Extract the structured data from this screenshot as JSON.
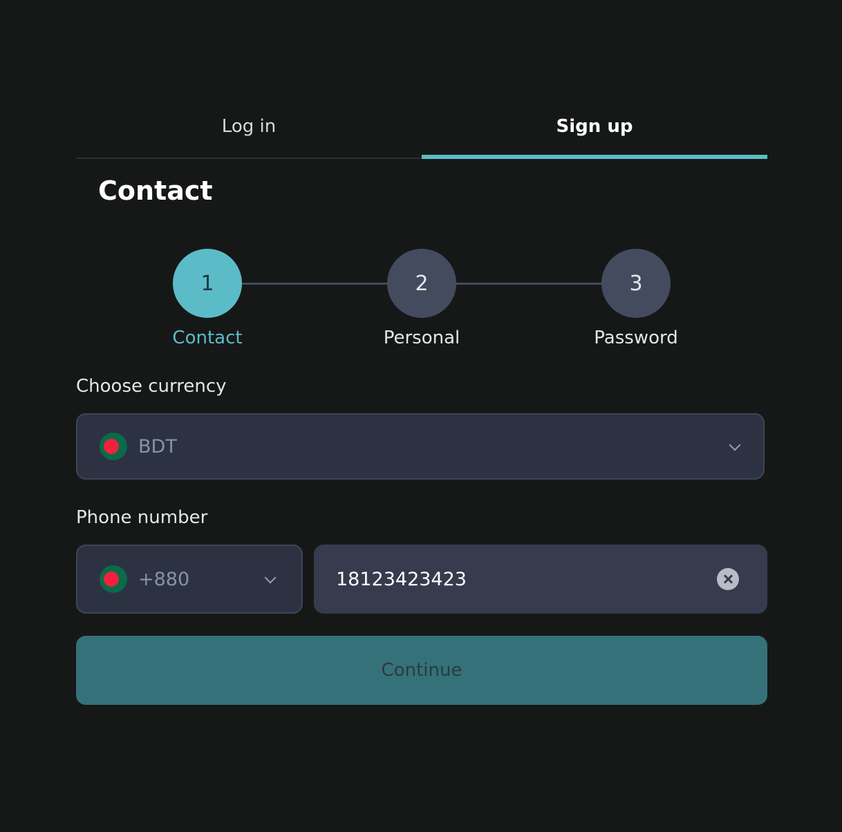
{
  "tabs": {
    "login_label": "Log in",
    "signup_label": "Sign up",
    "active": "signup"
  },
  "section": {
    "title": "Contact"
  },
  "stepper": {
    "active_step": 1,
    "steps": [
      {
        "number": "1",
        "label": "Contact"
      },
      {
        "number": "2",
        "label": "Personal"
      },
      {
        "number": "3",
        "label": "Password"
      }
    ]
  },
  "currency": {
    "label": "Choose currency",
    "value": "BDT",
    "flag_icon": "bangladesh-flag-icon"
  },
  "phone": {
    "label": "Phone number",
    "country_code": "+880",
    "value": "18123423423"
  },
  "actions": {
    "continue_label": "Continue"
  },
  "colors": {
    "accent": "#5bbcc7",
    "background": "#161818",
    "field_bg": "#2c3242",
    "button_bg": "#357178"
  }
}
